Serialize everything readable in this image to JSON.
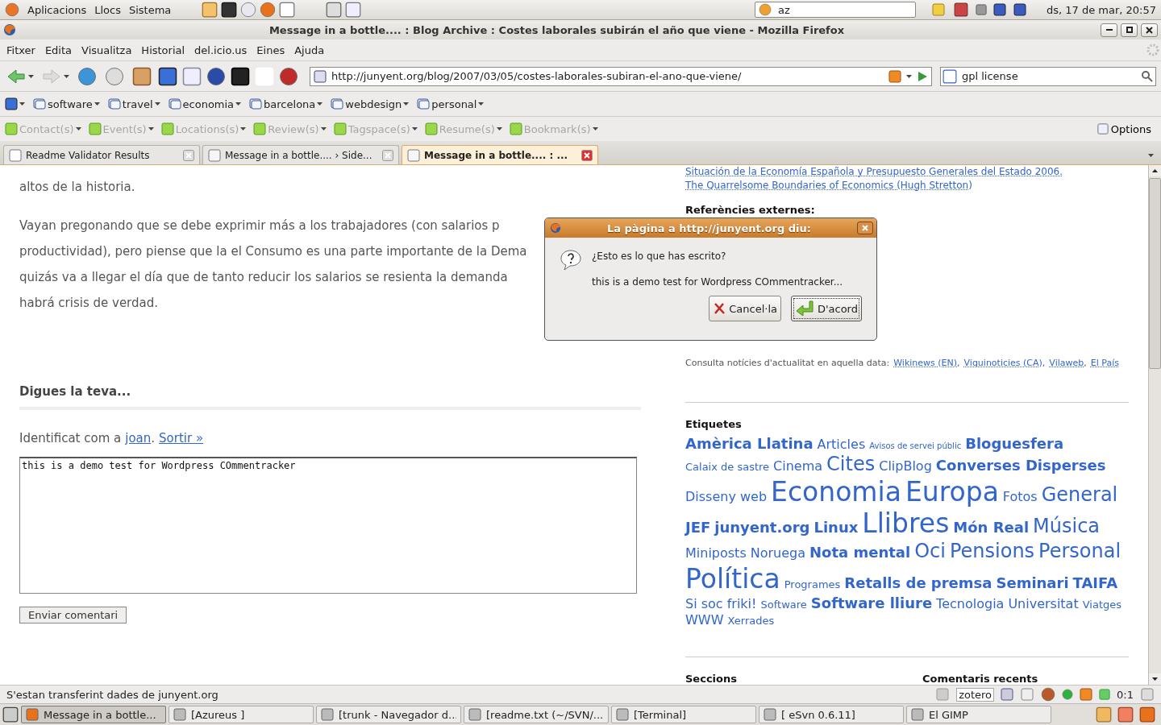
{
  "top_panel": {
    "menus": [
      "Aplicacions",
      "Llocs",
      "Sistema"
    ],
    "search_value": "az",
    "clock": "ds, 17 de mar, 20:57"
  },
  "window": {
    "title": "Message in a bottle.... : Blog Archive : Costes laborales subirán el año que viene - Mozilla Firefox"
  },
  "menubar": [
    "Fitxer",
    "Edita",
    "Visualitza",
    "Historial",
    "del.icio.us",
    "Eines",
    "Ajuda"
  ],
  "url": "http://junyent.org/blog/2007/03/05/costes-laborales-subiran-el-ano-que-viene/",
  "search": {
    "value": "gpl license"
  },
  "bookmarks": [
    "software",
    "travel",
    "economia",
    "barcelona",
    "webdesign",
    "personal"
  ],
  "microformats": [
    {
      "label": "Contact(s)",
      "disabled": true
    },
    {
      "label": "Event(s)",
      "disabled": true
    },
    {
      "label": "Locations(s)",
      "disabled": true
    },
    {
      "label": "Review(s)",
      "disabled": true
    },
    {
      "label": "Tagspace(s)",
      "disabled": true
    },
    {
      "label": "Resume(s)",
      "disabled": true
    },
    {
      "label": "Bookmark(s)",
      "disabled": true
    }
  ],
  "options": "Options",
  "tabs": [
    {
      "label": "Readme Validator Results",
      "selected": false
    },
    {
      "label": "Message in a bottle.... › Side...",
      "selected": false
    },
    {
      "label": "Message in a bottle.... : ...",
      "selected": true
    }
  ],
  "article": {
    "lines": [
      "altos de la historia.",
      "Vayan pregonando que se debe exprimir más a los trabajadores (con salarios p",
      "productividad), pero piense que la el Consumo es una parte importante de la Dema",
      "quizás va a llegar el día que de tanto reducir los salarios se resienta la demanda",
      "habrá crisis de verdad."
    ],
    "comment_heading": "Digues la teva...",
    "identified": {
      "text": "Identificat com a",
      "user": "joan",
      "separator": ".",
      "logout": "Sortir »"
    },
    "comment": {
      "value": "this is a demo test for Wordpress COmmentracker"
    },
    "submit": "Enviar comentari"
  },
  "sidebar": {
    "links": [
      "Situación de la Economía Española y Presupuesto Generales del Estado 2006.",
      "The Quarrelsome Boundaries of Economics (Hugh Stretton)"
    ],
    "external_heading": "Referències externes:",
    "news": {
      "text": "Consulta notícies d'actualitat en aquella data:",
      "links": [
        "Wikinews (EN)",
        "Viquinoticies (CA)",
        "Vilaweb",
        "El País"
      ],
      "separator": ","
    },
    "tags_heading": "Etiquetes",
    "tags": [
      {
        "label": "Amèrica Llatina",
        "kind": "large",
        "bold": true
      },
      {
        "label": "Articles",
        "kind": "medium",
        "bold": false
      },
      {
        "label": "Avisos de servei públic",
        "kind": "tiny",
        "bold": false
      },
      {
        "label": "Bloguesfera",
        "kind": "large",
        "bold": true
      },
      {
        "label": "Calaix de sastre",
        "kind": "small",
        "bold": false
      },
      {
        "label": "Cinema",
        "kind": "medium",
        "bold": false
      },
      {
        "label": "Cites",
        "kind": "huge",
        "bold": false
      },
      {
        "label": "ClipBlog",
        "kind": "medium",
        "bold": false
      },
      {
        "label": "Converses Disperses",
        "kind": "large",
        "bold": true
      },
      {
        "label": "Disseny web",
        "kind": "medium",
        "bold": false
      },
      {
        "label": "Economia",
        "kind": "giant",
        "bold": false
      },
      {
        "label": "Europa",
        "kind": "giant",
        "bold": false
      },
      {
        "label": "Fotos",
        "kind": "medium",
        "bold": false
      },
      {
        "label": "General",
        "kind": "huge",
        "bold": false
      },
      {
        "label": "JEF",
        "kind": "large",
        "bold": true
      },
      {
        "label": "junyent.org",
        "kind": "large",
        "bold": true
      },
      {
        "label": "Linux",
        "kind": "large",
        "bold": true
      },
      {
        "label": "Llibres",
        "kind": "giant",
        "bold": false
      },
      {
        "label": "Món Real",
        "kind": "large",
        "bold": true
      },
      {
        "label": "Música",
        "kind": "huge",
        "bold": false
      },
      {
        "label": "Miniposts",
        "kind": "medium",
        "bold": false
      },
      {
        "label": "Noruega",
        "kind": "medium",
        "bold": false
      },
      {
        "label": "Nota mental",
        "kind": "large",
        "bold": true
      },
      {
        "label": "Oci",
        "kind": "huge",
        "bold": false
      },
      {
        "label": "Pensions",
        "kind": "huge",
        "bold": false
      },
      {
        "label": "Personal",
        "kind": "huge",
        "bold": false
      },
      {
        "label": "Política",
        "kind": "giant",
        "bold": false
      },
      {
        "label": "Programes",
        "kind": "small",
        "bold": false
      },
      {
        "label": "Retalls de premsa",
        "kind": "large",
        "bold": true
      },
      {
        "label": "Seminari",
        "kind": "large",
        "bold": true
      },
      {
        "label": "TAIFA",
        "kind": "large",
        "bold": true
      },
      {
        "label": "Si soc friki!",
        "kind": "medium",
        "bold": false
      },
      {
        "label": "Software",
        "kind": "small",
        "bold": false
      },
      {
        "label": "Software lliure",
        "kind": "large",
        "bold": true
      },
      {
        "label": "Tecnologia",
        "kind": "medium",
        "bold": false
      },
      {
        "label": "Universitat",
        "kind": "medium",
        "bold": false
      },
      {
        "label": "Viatges",
        "kind": "small",
        "bold": false
      },
      {
        "label": "WWW",
        "kind": "medium",
        "bold": false
      },
      {
        "label": "Xerrades",
        "kind": "small",
        "bold": false
      }
    ],
    "sections_heading": "Seccions",
    "recent_heading": "Comentaris recents"
  },
  "dialog": {
    "title": "La pàgina a http://junyent.org diu:",
    "question": "¿Esto es lo que has escrito?",
    "message": "this is a demo test for Wordpress COmmentracker...",
    "buttons": [
      {
        "label": "Cancel·la",
        "kind": "cancel",
        "selected": false
      },
      {
        "label": "D'acord",
        "kind": "ok",
        "selected": true
      }
    ]
  },
  "status_bar": {
    "text": "S'estan transferint dades de junyent.org",
    "zotero": "zotero",
    "counter": "0:1"
  },
  "taskbar": [
    {
      "label": "Message in a bottle...",
      "selected": true
    },
    {
      "label": "[Azureus ]",
      "selected": false
    },
    {
      "label": "[trunk - Navegador d...",
      "selected": false
    },
    {
      "label": "[readme.txt (~/SVN/...",
      "selected": false
    },
    {
      "label": "[Terminal]",
      "selected": false
    },
    {
      "label": "[ eSvn 0.6.11]",
      "selected": false
    },
    {
      "label": "El GIMP",
      "selected": false
    }
  ]
}
